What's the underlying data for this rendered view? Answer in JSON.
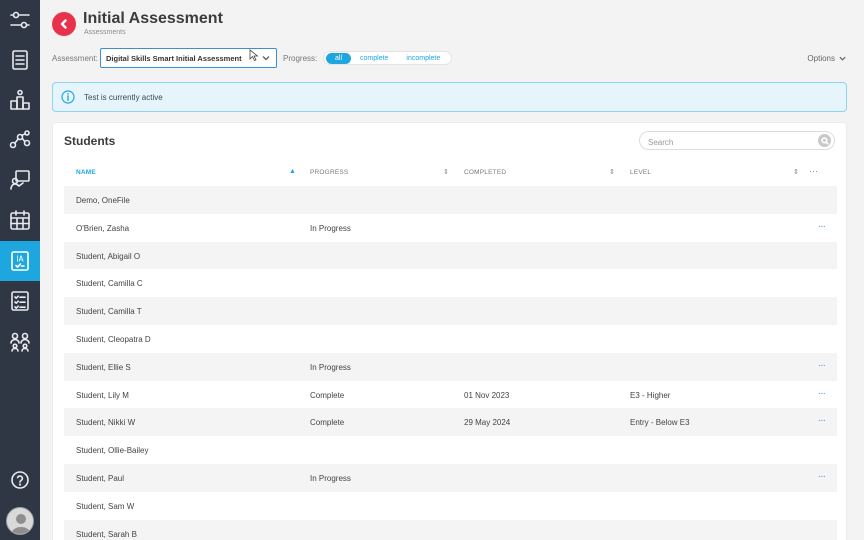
{
  "header": {
    "title": "Initial Assessment",
    "subtitle": "Assessments"
  },
  "filters": {
    "assessment_label": "Assessment:",
    "assessment_value": "Digital Skills Smart Initial Assessment",
    "progress_label": "Progress:",
    "progress_options": [
      {
        "label": "all",
        "active": true
      },
      {
        "label": "complete",
        "active": false
      },
      {
        "label": "incomplete",
        "active": false
      }
    ],
    "options_label": "Options"
  },
  "alert": {
    "icon": "info-icon",
    "message": "Test is currently active"
  },
  "students": {
    "title": "Students",
    "search_placeholder": "Search",
    "columns": [
      {
        "label": "NAME",
        "sorted": "asc"
      },
      {
        "label": "PROGRESS"
      },
      {
        "label": "COMPLETED"
      },
      {
        "label": "LEVEL"
      }
    ],
    "rows": [
      {
        "name": "Demo, OneFile",
        "progress": "",
        "completed": "",
        "level": "",
        "more": ""
      },
      {
        "name": "O'Brien, Zasha",
        "progress": "In Progress",
        "completed": "",
        "level": "",
        "more": "···"
      },
      {
        "name": "Student, Abigail O",
        "progress": "",
        "completed": "",
        "level": "",
        "more": ""
      },
      {
        "name": "Student, Camilla C",
        "progress": "",
        "completed": "",
        "level": "",
        "more": ""
      },
      {
        "name": "Student, Camilla T",
        "progress": "",
        "completed": "",
        "level": "",
        "more": ""
      },
      {
        "name": "Student, Cleopatra D",
        "progress": "",
        "completed": "",
        "level": "",
        "more": ""
      },
      {
        "name": "Student, Ellie S",
        "progress": "In Progress",
        "completed": "",
        "level": "",
        "more": "···"
      },
      {
        "name": "Student, Lily M",
        "progress": "Complete",
        "completed": "01 Nov 2023",
        "level": "E3 - Higher",
        "more": "···"
      },
      {
        "name": "Student, Nikki W",
        "progress": "Complete",
        "completed": "29 May 2024",
        "level": "Entry - Below E3",
        "more": "···"
      },
      {
        "name": "Student, Ollie-Bailey",
        "progress": "",
        "completed": "",
        "level": "",
        "more": ""
      },
      {
        "name": "Student, Paul",
        "progress": "In Progress",
        "completed": "",
        "level": "",
        "more": "···"
      },
      {
        "name": "Student, Sam W",
        "progress": "",
        "completed": "",
        "level": "",
        "more": ""
      },
      {
        "name": "Student, Sarah B",
        "progress": "",
        "completed": "",
        "level": "",
        "more": ""
      }
    ]
  },
  "sidebar": {
    "items": [
      {
        "icon": "settings-sliders-icon"
      },
      {
        "icon": "list-icon"
      },
      {
        "icon": "podium-icon"
      },
      {
        "icon": "network-icon"
      },
      {
        "icon": "presenter-icon"
      },
      {
        "icon": "calendar-icon"
      },
      {
        "icon": "initial-assessment-icon",
        "label": "IA",
        "active": true
      },
      {
        "icon": "checklist-icon"
      },
      {
        "icon": "people-group-icon"
      }
    ],
    "help_icon": "help-icon"
  },
  "colors": {
    "sidebar_bg": "#2f3644",
    "accent": "#1ea7de",
    "back_button": "#e8324c",
    "alert_bg": "#e6f4fb"
  }
}
